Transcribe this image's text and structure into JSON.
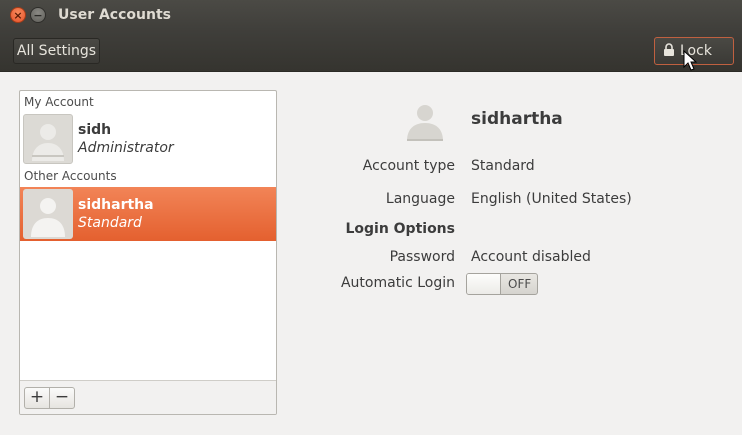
{
  "window": {
    "title": "User Accounts",
    "close_glyph": "×",
    "minimize_glyph": "−"
  },
  "toolbar": {
    "all_settings_label": "All Settings",
    "lock_label": "Lock",
    "lock_icon": "lock-icon"
  },
  "user_list": {
    "my_account_label": "My Account",
    "other_accounts_label": "Other Accounts",
    "users": [
      {
        "name": "sidh",
        "role": "Administrator",
        "selected": false
      },
      {
        "name": "sidhartha",
        "role": "Standard",
        "selected": true
      }
    ],
    "add_label": "+",
    "remove_label": "−"
  },
  "details": {
    "name": "sidhartha",
    "account_type_label": "Account type",
    "account_type_value": "Standard",
    "language_label": "Language",
    "language_value": "English (United States)",
    "login_options_label": "Login Options",
    "password_label": "Password",
    "password_value": "Account disabled",
    "auto_login_label": "Automatic Login",
    "auto_login_state": "OFF"
  },
  "colors": {
    "selection": "#e96a3c",
    "window_bg": "#f2f1f0",
    "titlebar": "#3f3e3a",
    "close_button": "#e5512a"
  }
}
